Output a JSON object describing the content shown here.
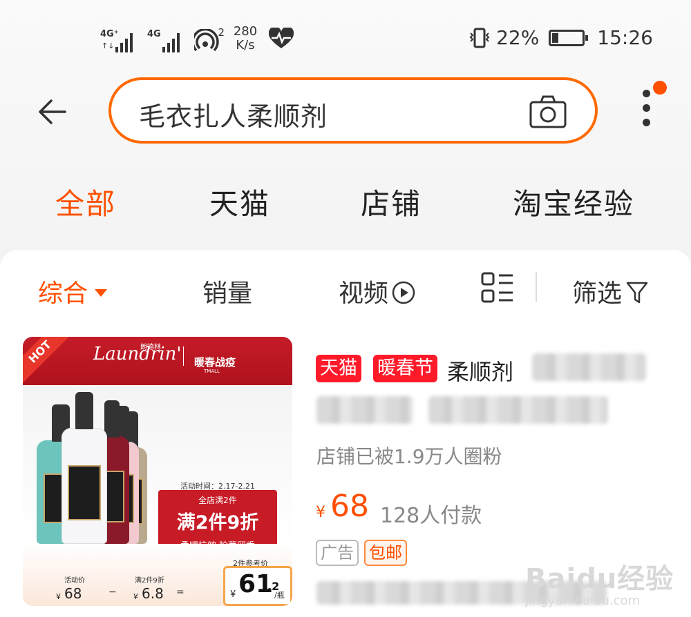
{
  "status_bar": {
    "net1": "4G⁺",
    "net2": "4G",
    "hotspot_count": "2",
    "speed_value": "280",
    "speed_unit": "K/s",
    "battery_percent": "22%",
    "battery_level": 0.22,
    "time": "15:26"
  },
  "search": {
    "query": "毛衣扎人柔顺剂"
  },
  "tabs": [
    {
      "label": "全部",
      "active": true
    },
    {
      "label": "天猫",
      "active": false
    },
    {
      "label": "店铺",
      "active": false
    },
    {
      "label": "淘宝经验",
      "active": false
    }
  ],
  "sort_bar": {
    "comprehensive": "综合",
    "sales": "销量",
    "video": "视频",
    "filter": "筛选"
  },
  "product": {
    "image": {
      "hot": "HOT",
      "brand": "Laundrin'",
      "brand_cn": "朗德林",
      "campaign": "暖春战疫",
      "campaign_sub": "TMALL",
      "promo_time": "活动时间：2.17-2.21",
      "promo_sub": "全店满2件",
      "promo_main": "满2件9折",
      "promo_foot": "柔顺抗皱 除菌留香",
      "activity_price_label": "活动价",
      "activity_price": "68",
      "discount_label": "满2件9折",
      "discount_value": "6.8",
      "minus": "−",
      "equals": "=",
      "yen": "¥",
      "ref_price_label": "2件参考价",
      "ref_price_int": "61",
      "ref_price_dec": ".2",
      "ref_price_unit": "/瓶"
    },
    "tag_tmall": "天猫",
    "tag_festival": "暖春节",
    "title": "柔顺剂",
    "fans": "店铺已被1.9万人圈粉",
    "currency": "¥",
    "price": "68",
    "paid_count": "128人付款",
    "chip_ad": "广告",
    "chip_shipping": "包邮"
  },
  "watermark": {
    "main": "Baidu经验",
    "sub": "jingyan.baidu.com"
  },
  "colors": {
    "accent": "#ff5000",
    "search_border": "#ff6a00",
    "tag_red": "#ff1a2a"
  }
}
